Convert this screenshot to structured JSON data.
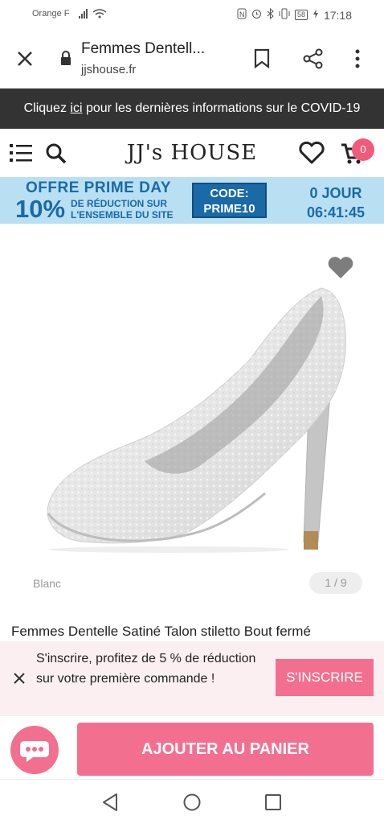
{
  "status_bar": {
    "carrier": "Orange F",
    "battery": "58",
    "time": "17:18"
  },
  "browser": {
    "page_title": "Femmes Dentell...",
    "url": "jjshouse.fr"
  },
  "covid_banner": {
    "prefix": "Cliquez ",
    "link": "ici",
    "suffix": " pour les dernières informations sur le COVID-19"
  },
  "header": {
    "logo": "JJ's HOUSE",
    "cart_count": "0"
  },
  "promo": {
    "title": "OFFRE PRIME DAY",
    "percent": "10%",
    "line1": "DE RÉDUCTION SUR",
    "line2": "L'ENSEMBLE DU SITE",
    "code_label": "CODE:",
    "code_value": "PRIME10",
    "countdown_days": "0 JOUR",
    "countdown_time": "06:41:45"
  },
  "product": {
    "color": "Blanc",
    "image_counter": "1 / 9",
    "name": "Femmes Dentelle Satiné Talon stiletto Bout fermé"
  },
  "newsletter": {
    "text": "S'inscrire, profitez de 5 % de réduction sur votre première commande !",
    "button": "S'INSCRIRE"
  },
  "actions": {
    "add_to_cart": "AJOUTER AU PANIER"
  },
  "colors": {
    "brand_pink": "#f36f8f",
    "promo_bg": "#b9dff3",
    "promo_text": "#1a6aa8",
    "banner_bg": "#333333"
  }
}
